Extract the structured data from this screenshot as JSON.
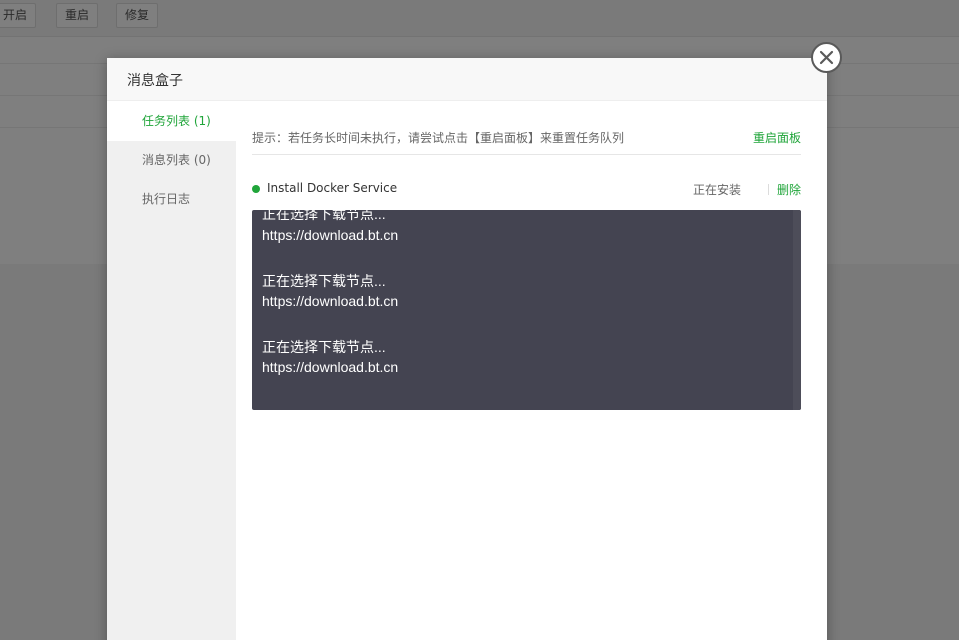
{
  "background": {
    "toolbar_buttons": [
      "开启",
      "重启",
      "修复"
    ]
  },
  "modal": {
    "title": "消息盒子",
    "sidebar": {
      "items": [
        {
          "label": "任务列表 (1)",
          "active": true
        },
        {
          "label": "消息列表 (0)",
          "active": false
        },
        {
          "label": "执行日志",
          "active": false
        }
      ]
    },
    "tip": {
      "text": "提示：若任务长时间未执行，请尝试点击【重启面板】来重置任务队列",
      "restart_label": "重启面板"
    },
    "task": {
      "name": "Install Docker Service",
      "status": "正在安装",
      "delete_label": "删除"
    },
    "log_lines": [
      "正在选择下载节点...",
      "https://download.bt.cn",
      "",
      "正在选择下载节点...",
      "https://download.bt.cn",
      "",
      "正在选择下载节点...",
      "https://download.bt.cn"
    ]
  },
  "colors": {
    "accent": "#20a53a",
    "log_background": "#444451",
    "overlay": "rgba(0,0,0,0.5)"
  },
  "icons": {
    "close": "close-icon",
    "status": "status-dot-icon"
  }
}
